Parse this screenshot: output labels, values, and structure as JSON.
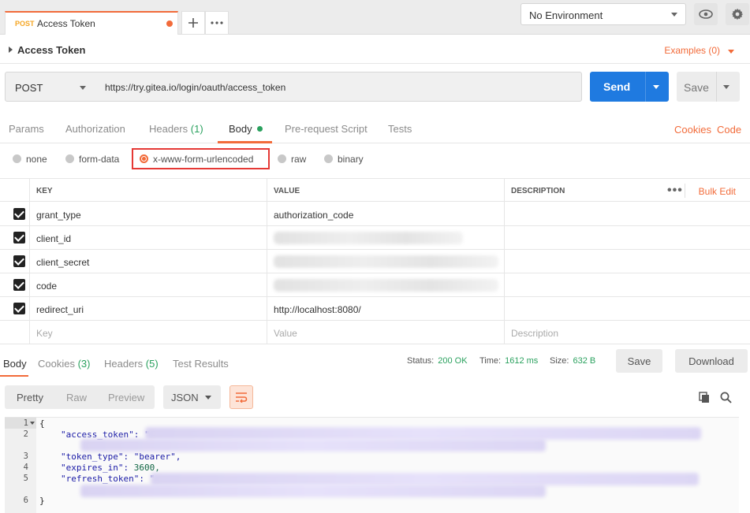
{
  "tab": {
    "method": "POST",
    "name": "Access Token"
  },
  "environment": "No Environment",
  "title": "Access Token",
  "examples": "Examples (0)",
  "request": {
    "method": "POST",
    "url": "https://try.gitea.io/login/oauth/access_token",
    "send_label": "Send",
    "save_label": "Save"
  },
  "req_tabs": {
    "params": "Params",
    "authorization": "Authorization",
    "headers": "Headers",
    "headers_count": "(1)",
    "body": "Body",
    "prerequest": "Pre-request Script",
    "tests": "Tests",
    "cookies": "Cookies",
    "code": "Code"
  },
  "body_types": [
    "none",
    "form-data",
    "x-www-form-urlencoded",
    "raw",
    "binary"
  ],
  "table": {
    "headers": {
      "key": "KEY",
      "value": "VALUE",
      "description": "DESCRIPTION",
      "bulk_edit": "Bulk Edit"
    },
    "rows": [
      {
        "key": "grant_type",
        "value": "authorization_code"
      },
      {
        "key": "client_id",
        "value": ""
      },
      {
        "key": "client_secret",
        "value": ""
      },
      {
        "key": "code",
        "value": ""
      },
      {
        "key": "redirect_uri",
        "value": "http://localhost:8080/"
      }
    ],
    "placeholders": {
      "key": "Key",
      "value": "Value",
      "description": "Description"
    }
  },
  "response": {
    "tabs": {
      "body": "Body",
      "cookies": "Cookies",
      "cookies_count": "(3)",
      "headers": "Headers",
      "headers_count": "(5)",
      "test_results": "Test Results"
    },
    "status_label": "Status:",
    "status": "200 OK",
    "time_label": "Time:",
    "time": "1612 ms",
    "size_label": "Size:",
    "size": "632 B",
    "save": "Save",
    "download": "Download",
    "formats": {
      "pretty": "Pretty",
      "raw": "Raw",
      "preview": "Preview"
    },
    "lang": "JSON"
  },
  "json_lines": {
    "open": "{",
    "access_token_key": "\"access_token\": \"",
    "token_type": "\"token_type\": ",
    "token_type_val": "\"bearer\",",
    "expires_in": "\"expires_in\": ",
    "expires_in_val": "3600,",
    "refresh_token_key": "\"refresh_token\": \"",
    "close": "}",
    "line_numbers": [
      "1",
      "2",
      "3",
      "4",
      "5",
      "6"
    ]
  },
  "colors": {
    "accent": "#f26b3a",
    "send": "#1f7ae0",
    "success": "#2aa15e",
    "highlight": "#e53935"
  }
}
